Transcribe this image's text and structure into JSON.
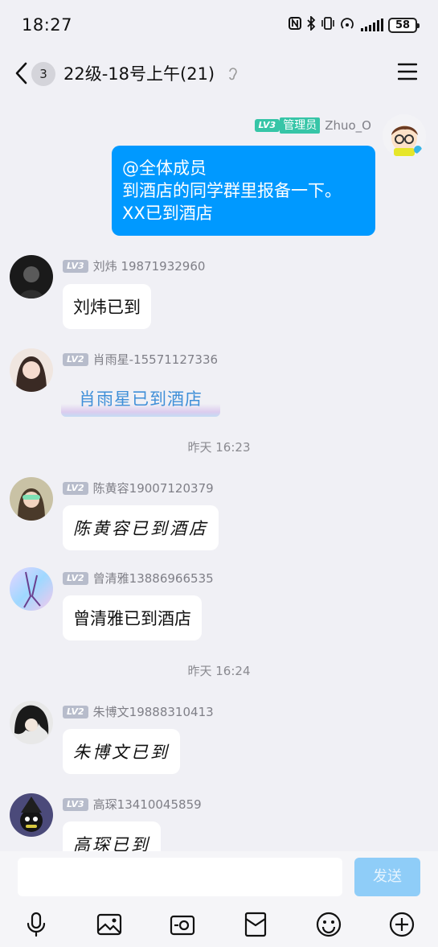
{
  "status_bar": {
    "time": "18:27",
    "battery": "58"
  },
  "header": {
    "unread_count": "3",
    "title": "22级-18号上午(21)"
  },
  "messages": [
    {
      "level": "LV3",
      "role": "管理员",
      "sender": "Zhuo_O",
      "lines": [
        "@全体成员",
        "到酒店的同学群里报备一下。",
        "XX已到酒店"
      ]
    },
    {
      "level": "LV3",
      "sender": "刘炜 19871932960",
      "text": "刘炜已到"
    },
    {
      "level": "LV2",
      "sender": "肖雨星-15571127336",
      "text": "肖雨星已到酒店"
    },
    {
      "timestamp": "昨天 16:23"
    },
    {
      "level": "LV2",
      "sender": "陈黄容19007120379",
      "text": "陈黄容已到酒店"
    },
    {
      "level": "LV2",
      "sender": "曾清雅13886966535",
      "text": "曾清雅已到酒店"
    },
    {
      "timestamp": "昨天 16:24"
    },
    {
      "level": "LV2",
      "sender": "朱博文19888310413",
      "text": "朱博文已到"
    },
    {
      "level": "LV3",
      "sender": "高琛13410045859",
      "text": "高琛已到"
    }
  ],
  "input": {
    "placeholder": "",
    "send_label": "发送"
  },
  "toolbar": [
    "microphone-icon",
    "image-icon",
    "camera-icon",
    "red-packet-icon",
    "emoji-icon",
    "plus-icon"
  ],
  "colors": {
    "accent": "#0099ff",
    "admin_badge": "#36c5a7",
    "send_disabled": "#8fcdf8"
  }
}
